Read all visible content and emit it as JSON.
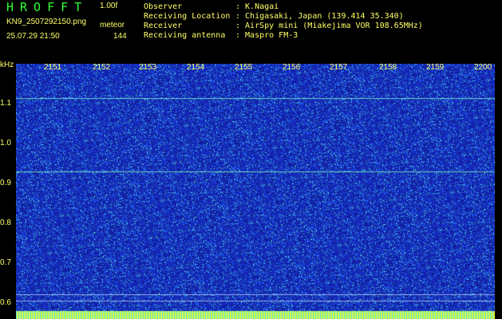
{
  "header": {
    "app_title": "HROFFT",
    "version": "1.00f",
    "filename": "KN9_2507292150.png",
    "mode": "meteor",
    "datetime": "25.07.29 21:50",
    "count": "144"
  },
  "info": [
    {
      "key": "Observer",
      "value": ": K.Nagai"
    },
    {
      "key": "Receiving Location",
      "value": ": Chigasaki, Japan (139.414 35.340)"
    },
    {
      "key": "Receiver",
      "value": ": AirSpy mini (Miakejima VOR 108.65MHz)"
    },
    {
      "key": "Receiving antenna",
      "value": ": Maspro FM-3"
    }
  ],
  "axes": {
    "y_unit": "kHz",
    "x_ticks": [
      "2151",
      "2152",
      "2153",
      "2154",
      "2155",
      "2156",
      "2157",
      "2158",
      "2159",
      "2200"
    ],
    "y_ticks": [
      "1.1",
      "1.0",
      "0.9",
      "0.8",
      "0.7",
      "0.6"
    ]
  },
  "colors": {
    "background": "#000000",
    "text": "#ffff66",
    "title": "#33ff33",
    "waterfall_base": "#1a2fb0"
  }
}
